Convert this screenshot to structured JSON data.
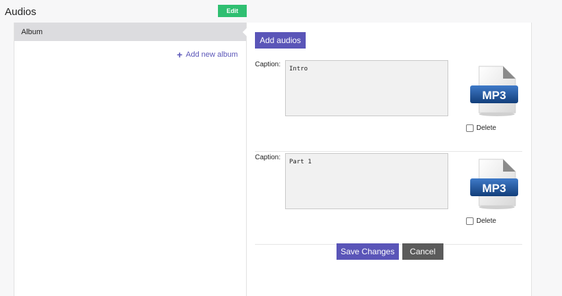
{
  "page": {
    "title": "Audios",
    "edit_label": "Edit"
  },
  "sidebar": {
    "album_header": "Album",
    "add_album_label": "Add new album"
  },
  "main": {
    "add_audios_label": "Add audios",
    "items": [
      {
        "caption_label": "Caption:",
        "caption_value": "Intro",
        "icon_text": "MP3",
        "delete_label": "Delete"
      },
      {
        "caption_label": "Caption:",
        "caption_value": "Part 1",
        "icon_text": "MP3",
        "delete_label": "Delete"
      }
    ],
    "save_label": "Save Changes",
    "cancel_label": "Cancel"
  },
  "colors": {
    "accent": "#5a55b8",
    "edit": "#2fbf71",
    "cancel": "#5b5b5b",
    "mp3_blue": "#1a4f8f"
  },
  "icons": {
    "add_album": "plus-icon",
    "file": "mp3-file-icon"
  }
}
